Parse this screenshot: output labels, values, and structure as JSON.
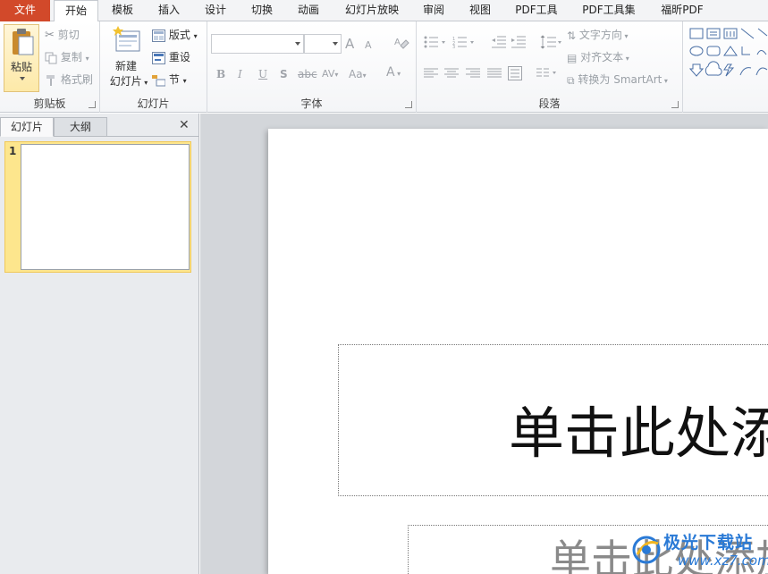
{
  "tabs": [
    "文件",
    "开始",
    "模板",
    "插入",
    "设计",
    "切换",
    "动画",
    "幻灯片放映",
    "审阅",
    "视图",
    "PDF工具",
    "PDF工具集",
    "福昕PDF"
  ],
  "active_tab": "开始",
  "ribbon": {
    "clipboard": {
      "paste": "粘贴",
      "cut": "剪切",
      "copy": "复制",
      "format_painter": "格式刷",
      "label": "剪贴板"
    },
    "slides": {
      "new_slide_line1": "新建",
      "new_slide_line2": "幻灯片",
      "layout": "版式",
      "reset": "重设",
      "section": "节",
      "label": "幻灯片"
    },
    "font": {
      "font_name": "",
      "font_size": "",
      "bold": "B",
      "italic": "I",
      "underline": "U",
      "shadow": "S",
      "strikethrough": "abc",
      "spacing": "AV",
      "change_case": "Aa",
      "font_color": "A",
      "grow": "A",
      "shrink": "A",
      "label": "字体"
    },
    "paragraph": {
      "text_direction": "文字方向",
      "align_text": "对齐文本",
      "convert_smartart": "转换为 SmartArt",
      "label": "段落"
    }
  },
  "left_pane": {
    "tab_slides": "幻灯片",
    "tab_outline": "大纲",
    "close": "✕",
    "slide_number": "1"
  },
  "slide": {
    "title_placeholder": "单击此处添",
    "subtitle_placeholder": "单击此处添加"
  },
  "watermark": {
    "title": "极光下载站",
    "url": "www.xz7.com"
  },
  "colors": {
    "file_tab": "#d2492a",
    "selected_thumb": "#fde68d",
    "watermark_blue": "#2a7ad6"
  }
}
